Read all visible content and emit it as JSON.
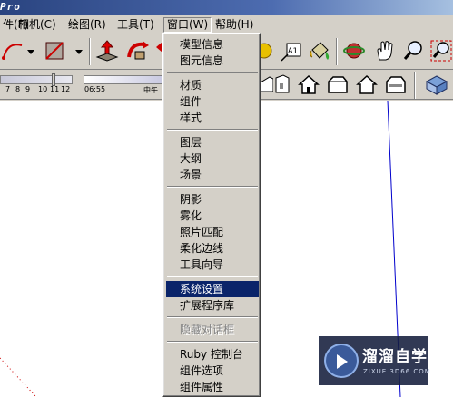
{
  "window": {
    "title": "Pro"
  },
  "menubar": {
    "items": [
      {
        "label": "件(F)"
      },
      {
        "label": "相机(C)"
      },
      {
        "label": "绘图(R)"
      },
      {
        "label": "工具(T)"
      },
      {
        "label": "窗口(W)"
      },
      {
        "label": "帮助(H)"
      }
    ]
  },
  "shadow_settings": {
    "month_ticks": [
      "7",
      "8",
      "9",
      "10",
      "11",
      "12"
    ],
    "time_label": "06:55",
    "noon_label": "中午"
  },
  "window_menu": {
    "groups": [
      {
        "items": [
          {
            "label": "模型信息"
          },
          {
            "label": "图元信息"
          }
        ]
      },
      {
        "items": [
          {
            "label": "材质"
          },
          {
            "label": "组件"
          },
          {
            "label": "样式"
          }
        ]
      },
      {
        "items": [
          {
            "label": "图层"
          },
          {
            "label": "大纲"
          },
          {
            "label": "场景"
          }
        ]
      },
      {
        "items": [
          {
            "label": "阴影"
          },
          {
            "label": "雾化"
          },
          {
            "label": "照片匹配"
          },
          {
            "label": "柔化边线"
          },
          {
            "label": "工具向导"
          }
        ]
      },
      {
        "items": [
          {
            "label": "系统设置",
            "highlighted": true
          },
          {
            "label": "扩展程序库"
          }
        ]
      },
      {
        "items": [
          {
            "label": "隐藏对话框",
            "disabled": true
          }
        ]
      },
      {
        "items": [
          {
            "label": "Ruby 控制台"
          },
          {
            "label": "组件选项"
          },
          {
            "label": "组件属性"
          }
        ]
      }
    ]
  },
  "toolbar": {
    "text_tool_label": "A1"
  },
  "watermark": {
    "title": "溜溜自学",
    "url": "ZIXUE.3D66.COM"
  },
  "colors": {
    "menu_highlight": "#0a246a",
    "title_bar": "#2a4480",
    "axis_blue": "#0000cc",
    "axis_red": "#cc0000"
  }
}
